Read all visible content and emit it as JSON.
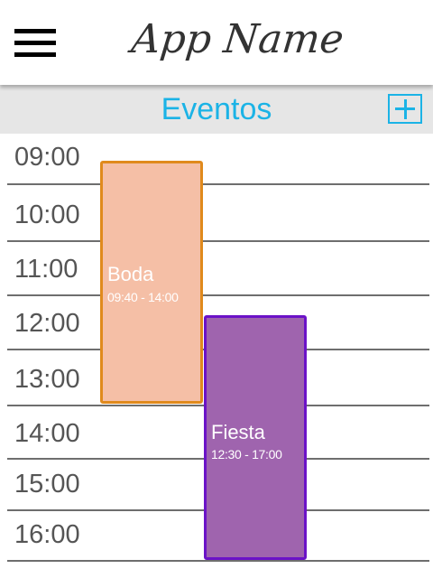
{
  "header": {
    "app_title": "App Name",
    "menu_icon": "hamburger-menu-icon"
  },
  "section": {
    "title": "Eventos",
    "add_icon": "plus-icon"
  },
  "timeline": {
    "hours": [
      "09:00",
      "10:00",
      "11:00",
      "12:00",
      "13:00",
      "14:00",
      "15:00",
      "16:00"
    ]
  },
  "events": [
    {
      "title": "Boda",
      "time": "09:40 - 14:00",
      "fill_color": "#f5bfa6",
      "border_color": "#e08a1d"
    },
    {
      "title": "Fiesta",
      "time": "12:30 - 17:00",
      "fill_color": "#9f64ae",
      "border_color": "#6b12c7"
    }
  ],
  "colors": {
    "accent": "#1bb3e6",
    "section_bar": "#e6e6e6",
    "grid_line": "#6e6e6e",
    "hour_text": "#555555"
  }
}
